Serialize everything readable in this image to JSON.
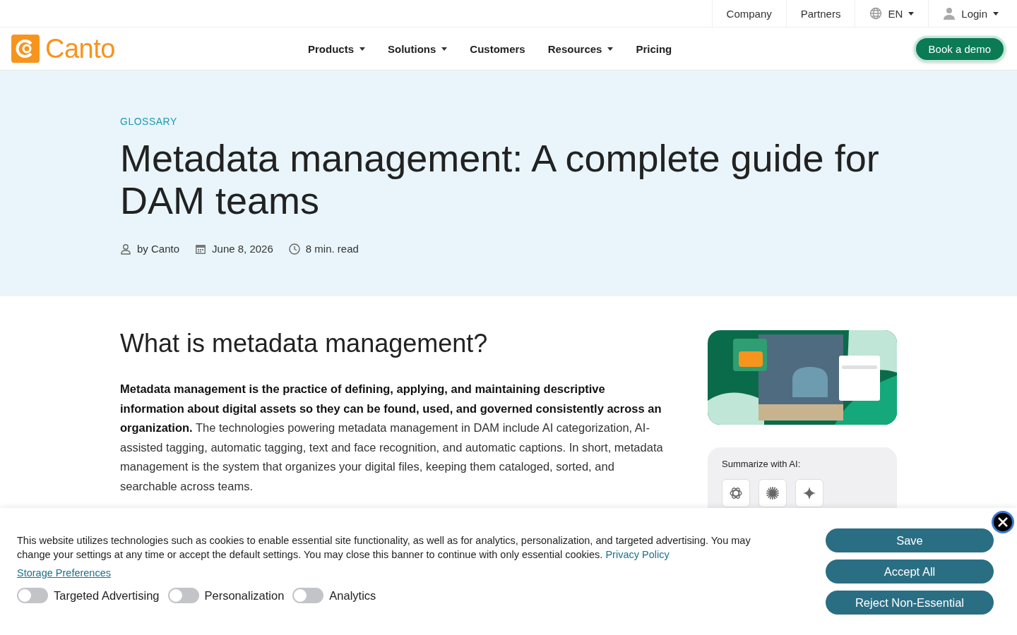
{
  "top_bar": {
    "items": [
      {
        "label": "Company",
        "kind": "link"
      },
      {
        "label": "Partners",
        "kind": "link"
      },
      {
        "label": "EN",
        "kind": "language"
      },
      {
        "label": "Login",
        "kind": "account"
      }
    ]
  },
  "nav": {
    "logo": "Canto",
    "items": [
      {
        "label": "Products",
        "dropdown": true
      },
      {
        "label": "Solutions",
        "dropdown": true
      },
      {
        "label": "Customers",
        "dropdown": false
      },
      {
        "label": "Resources",
        "dropdown": true
      },
      {
        "label": "Pricing",
        "dropdown": false
      }
    ],
    "cta": "Book a demo"
  },
  "hero": {
    "eyebrow": "GLOSSARY",
    "title": "Metadata management: A complete guide for DAM teams",
    "meta": [
      {
        "kind": "author",
        "text": "by Canto"
      },
      {
        "kind": "date",
        "text": "June 8, 2026"
      },
      {
        "kind": "time",
        "text": "8 min. read"
      }
    ]
  },
  "article": {
    "heading": "What is metadata management?",
    "paragraph": "**Metadata management is the practice of defining, applying, and maintaining descriptive information about digital assets so they can be found, used, and governed consistently across an organization.** The technologies powering metadata management in DAM include AI categorization, AI-assisted tagging, automatic tagging, text and face recognition, and automatic captions. In short, metadata management is the system that organizes your digital files, keeping them cataloged, sorted, and searchable across teams."
  },
  "sidebar": {
    "summarize_label": "Summarize with AI:",
    "ai_buttons": [
      {
        "kind": "knot"
      },
      {
        "kind": "asterisk"
      },
      {
        "kind": "sparkle"
      }
    ]
  },
  "cookie_banner": {
    "text": "This website utilizes technologies such as cookies to enable essential site functionality, as well as for analytics, personalization, and targeted advertising. You may change your settings at any time or accept the default settings. You may close this banner to continue with only essential cookies. ",
    "privacy_link": "Privacy Policy",
    "preferences_link": "Storage Preferences",
    "toggles": [
      {
        "label": "Targeted Advertising",
        "on": false
      },
      {
        "label": "Personalization",
        "on": false
      },
      {
        "label": "Analytics",
        "on": false
      }
    ],
    "buttons": [
      "Save",
      "Accept All",
      "Reject Non-Essential"
    ]
  }
}
